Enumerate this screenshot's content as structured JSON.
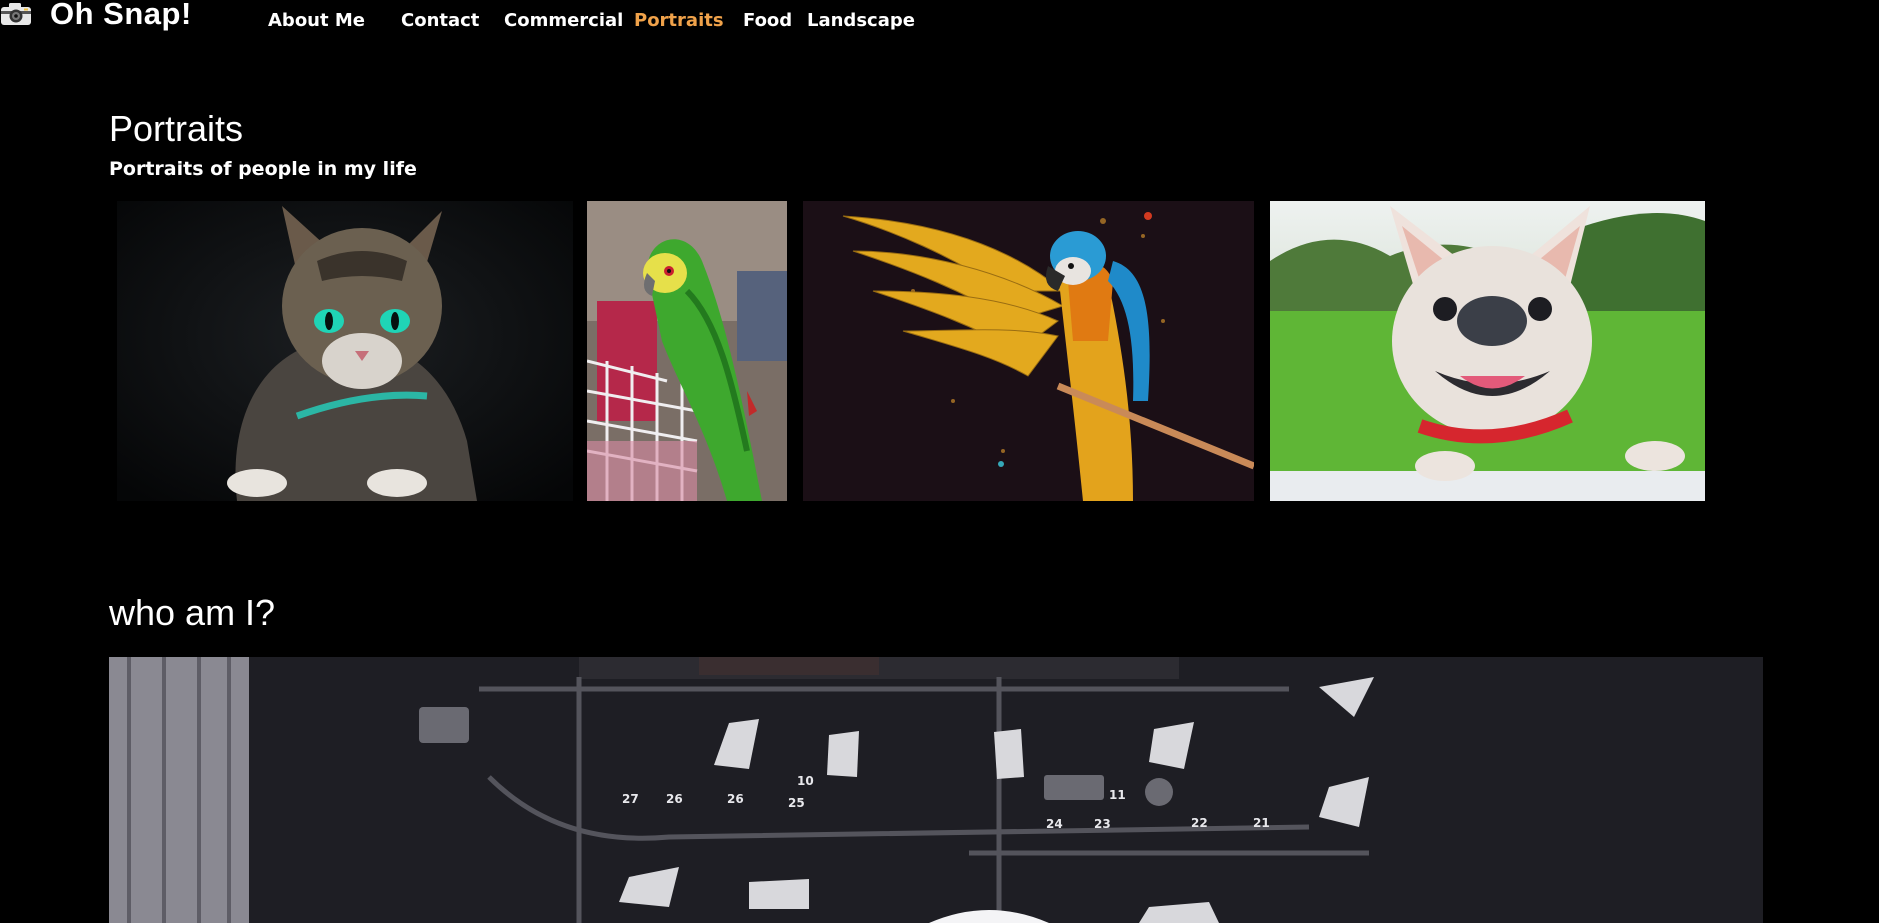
{
  "header": {
    "brand": "Oh Snap!",
    "logo_icon": "camera-icon",
    "nav": [
      {
        "label": "About Me"
      },
      {
        "label": "Contact"
      },
      {
        "label": "Commercial"
      },
      {
        "label": "Portraits",
        "active": true
      },
      {
        "label": "Food"
      },
      {
        "label": "Landscape"
      }
    ],
    "active_color": "#f0a24a"
  },
  "portraits": {
    "title": "Portraits",
    "subtitle": "Portraits of people in my life",
    "photos": [
      {
        "subject": "tabby cat with green eyes and teal collar"
      },
      {
        "subject": "green parrot perched on a cage"
      },
      {
        "subject": "blue-and-gold macaw spreading wings"
      },
      {
        "subject": "french bulldog with red collar"
      }
    ]
  },
  "about": {
    "title": "who am I?",
    "photo": {
      "subject": "photo studio lighting rig"
    },
    "rig_labels": [
      "10",
      "27",
      "26",
      "26",
      "25",
      "11",
      "24",
      "23",
      "22",
      "21"
    ]
  }
}
